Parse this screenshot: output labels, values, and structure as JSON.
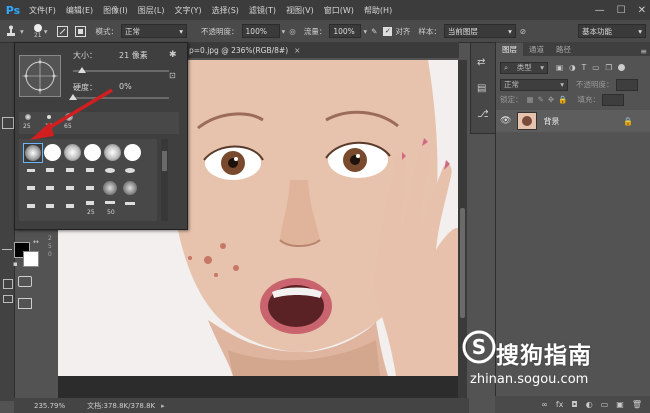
{
  "app": {
    "logo": "Ps"
  },
  "menubar": {
    "items": [
      "文件(F)",
      "编辑(E)",
      "图像(I)",
      "图层(L)",
      "文字(Y)",
      "选择(S)",
      "滤镜(T)",
      "视图(V)",
      "窗口(W)",
      "帮助(H)"
    ],
    "controls": [
      "—",
      "☐",
      "✕"
    ]
  },
  "options": {
    "size": "21",
    "mode_label": "模式：",
    "mode_value": "正常",
    "opacity_label": "不透明度：",
    "opacity_value": "100%",
    "flow_label": "流量：",
    "flow_value": "100%",
    "align_label": "对齐",
    "sample_label": "样本：",
    "sample_value": "当前图层",
    "workspace": "基本功能"
  },
  "document": {
    "tab_title": "p=0.jpg @ 236%(RGB/8#)",
    "close": "×"
  },
  "brush_popup": {
    "size_label": "大小：",
    "size_value": "21 像素",
    "hardness_label": "硬度：",
    "hardness_value": "0%",
    "top_numbers": [
      "25",
      "13",
      "65"
    ],
    "bottom_numbers": [
      "25",
      "50"
    ]
  },
  "layers_panel": {
    "tabs": [
      "图层",
      "通道",
      "路径"
    ],
    "kind_label": "类型",
    "blend_mode": "正常",
    "opacity_label": "不透明度：",
    "lock_label": "锁定：",
    "fill_label": "填充：",
    "layer_name": "背景",
    "bottom_icons": [
      "∞",
      "fx",
      "◘",
      "◐",
      "▭",
      "▣",
      "🗑"
    ]
  },
  "status": {
    "zoom": "235.79%",
    "doc_info": "文档:378.8K/378.8K"
  },
  "watermark": {
    "text": "搜狗指南",
    "url": "zhinan.sogou.com",
    "logo_char": "S"
  },
  "colors": {
    "accent": "#31a8ff",
    "arrow": "#d11f1f",
    "ui_dark": "#535353"
  }
}
